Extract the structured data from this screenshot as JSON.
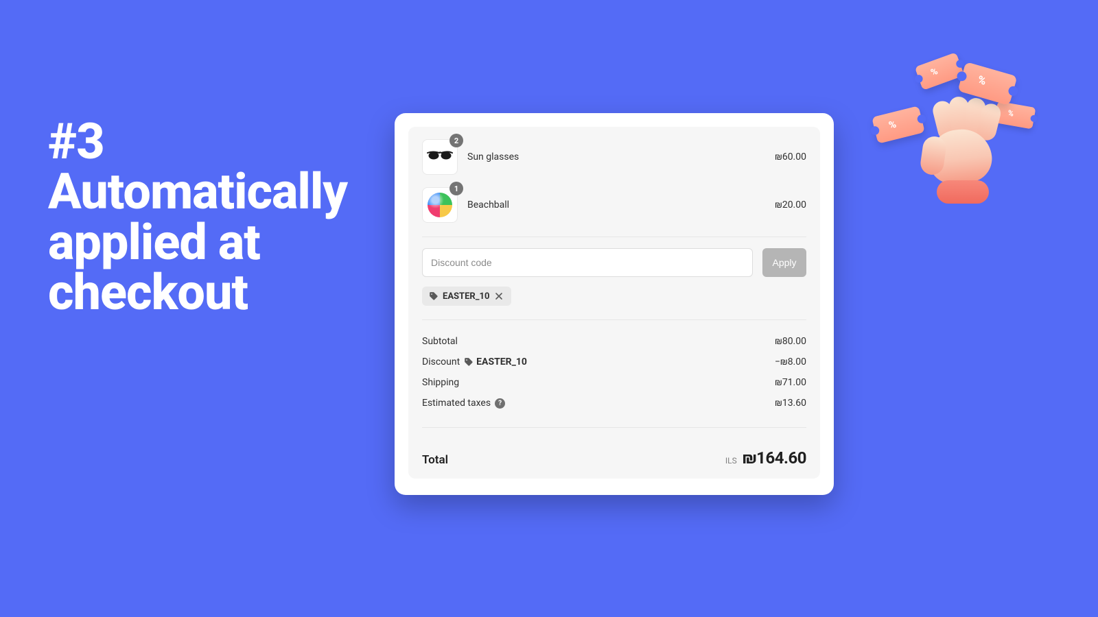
{
  "headline_part1": "#3",
  "headline_part2": "Automatically applied at checkout",
  "items": [
    {
      "name": "Sun glasses",
      "qty": "2",
      "price": "₪60.00"
    },
    {
      "name": "Beachball",
      "qty": "1",
      "price": "₪20.00"
    }
  ],
  "discount": {
    "placeholder": "Discount code",
    "apply_label": "Apply",
    "code": "EASTER_10"
  },
  "breakdown": {
    "subtotal_label": "Subtotal",
    "subtotal_value": "₪80.00",
    "discount_label": "Discount",
    "discount_code": "EASTER_10",
    "discount_value": "−₪8.00",
    "shipping_label": "Shipping",
    "shipping_value": "₪71.00",
    "taxes_label": "Estimated taxes",
    "taxes_value": "₪13.60"
  },
  "total": {
    "label": "Total",
    "currency": "ILS",
    "value": "₪164.60"
  }
}
